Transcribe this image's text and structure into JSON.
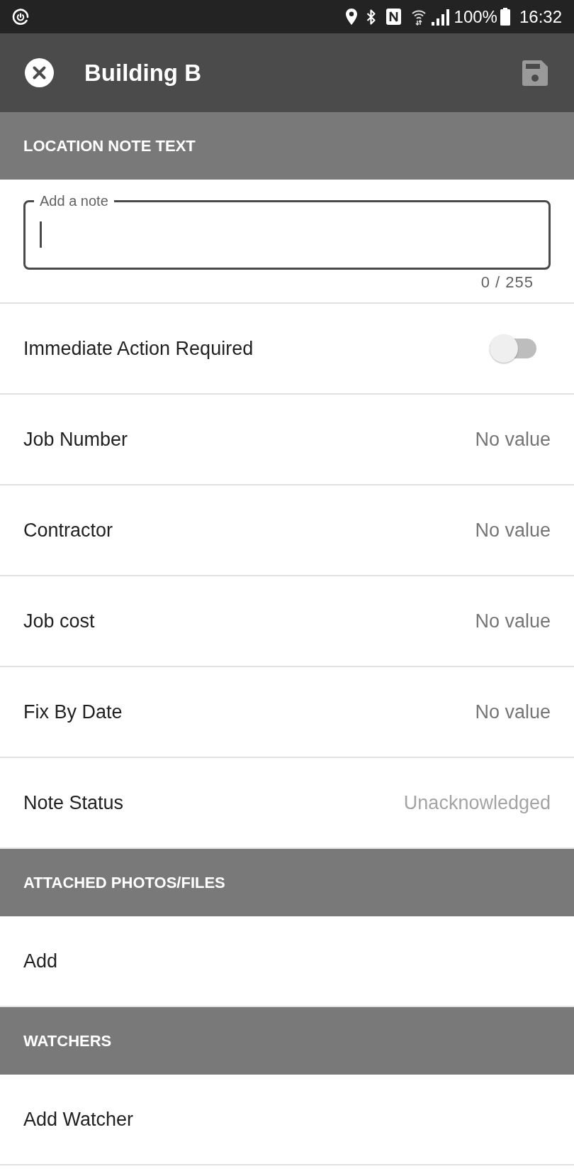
{
  "status_bar": {
    "battery": "100%",
    "time": "16:32"
  },
  "app_bar": {
    "title": "Building B",
    "save_button": {
      "disabled": true
    }
  },
  "sections": [
    {
      "title": "LOCATION NOTE TEXT",
      "items": [
        {
          "kind": "note",
          "label": "Add a note",
          "focused": true,
          "counter": "0 / 255"
        },
        {
          "kind": "toggle",
          "label": "Immediate Action Required",
          "on": false
        },
        {
          "kind": "value",
          "label": "Job Number",
          "value": "No value",
          "disabled": false
        },
        {
          "kind": "value",
          "label": "Contractor",
          "value": "No value",
          "disabled": false
        },
        {
          "kind": "value",
          "label": "Job cost",
          "value": "No value",
          "disabled": false
        },
        {
          "kind": "value",
          "label": "Fix By Date",
          "value": "No value",
          "disabled": false
        },
        {
          "kind": "value",
          "label": "Note Status",
          "value": "Unacknowledged",
          "disabled": true
        }
      ]
    },
    {
      "title": "ATTACHED PHOTOS/FILES",
      "items": [
        {
          "kind": "action",
          "label": "Add"
        }
      ]
    },
    {
      "title": "WATCHERS",
      "items": [
        {
          "kind": "action",
          "label": "Add Watcher"
        }
      ]
    }
  ]
}
